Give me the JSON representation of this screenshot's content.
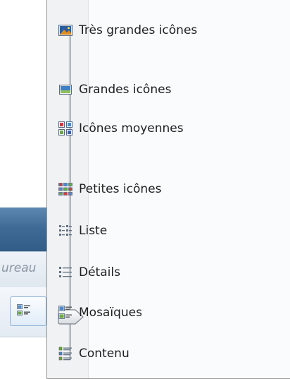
{
  "background": {
    "address_text": "ureau"
  },
  "view_menu": {
    "items": [
      {
        "label": "Très grandes icônes",
        "icon": "extra-large-icons-icon"
      },
      {
        "label": "Grandes icônes",
        "icon": "large-icons-icon"
      },
      {
        "label": "Icônes moyennes",
        "icon": "medium-icons-icon"
      },
      {
        "label": "Petites icônes",
        "icon": "small-icons-icon"
      },
      {
        "label": "Liste",
        "icon": "list-icon"
      },
      {
        "label": "Détails",
        "icon": "details-icon"
      },
      {
        "label": "Mosaïques",
        "icon": "tiles-icon"
      },
      {
        "label": "Contenu",
        "icon": "content-icon"
      }
    ],
    "selected": "Mosaïques"
  }
}
